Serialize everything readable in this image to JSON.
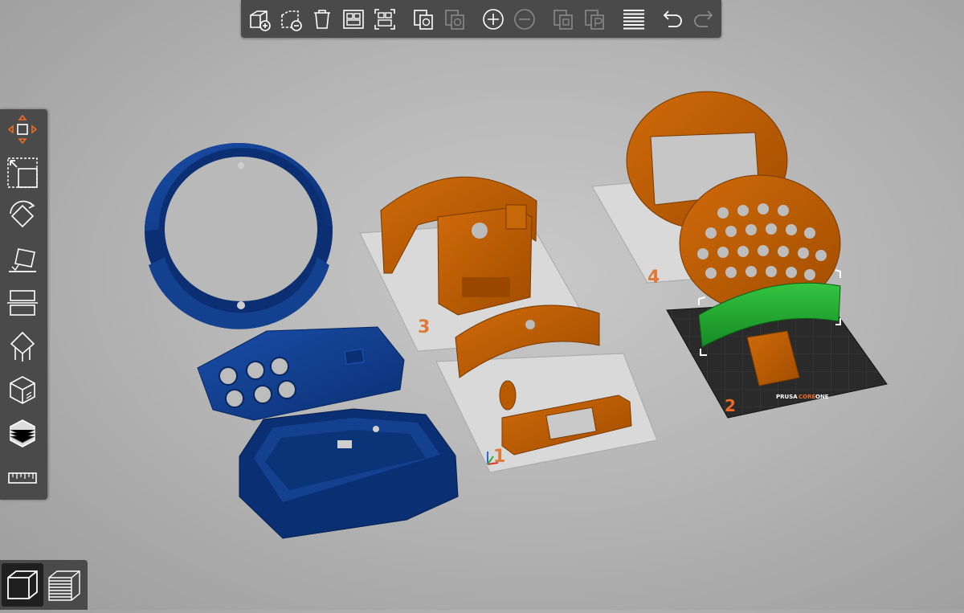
{
  "app": {
    "accent_color": "#ed6b21"
  },
  "top_toolbar": {
    "buttons": [
      {
        "name": "add-object",
        "icon": "cube-plus-icon",
        "enabled": true
      },
      {
        "name": "delete-selected",
        "icon": "cube-minus-dashed-icon",
        "enabled": true
      },
      {
        "name": "delete-all",
        "icon": "trash-icon",
        "enabled": true
      },
      {
        "name": "arrange",
        "icon": "arrange-icon",
        "enabled": true
      },
      {
        "name": "arrange-selection",
        "icon": "arrange-selection-icon",
        "enabled": true
      },
      {
        "name": "copy",
        "icon": "copy-icon",
        "enabled": true
      },
      {
        "name": "paste",
        "icon": "paste-icon",
        "enabled": false
      },
      {
        "name": "add-instance",
        "icon": "plus-circle-icon",
        "enabled": true
      },
      {
        "name": "remove-instance",
        "icon": "minus-circle-icon",
        "enabled": false
      },
      {
        "name": "split-to-objects",
        "icon": "split-objects-icon",
        "enabled": false
      },
      {
        "name": "split-to-parts",
        "icon": "split-parts-icon",
        "enabled": false
      },
      {
        "name": "variable-layer-height",
        "icon": "layers-icon",
        "enabled": true
      },
      {
        "name": "undo",
        "icon": "undo-icon",
        "enabled": true
      },
      {
        "name": "redo",
        "icon": "redo-icon",
        "enabled": false
      }
    ]
  },
  "left_toolbar": {
    "tools": [
      {
        "name": "move",
        "icon": "move-icon"
      },
      {
        "name": "scale",
        "icon": "scale-icon"
      },
      {
        "name": "rotate",
        "icon": "rotate-icon"
      },
      {
        "name": "place-on-face",
        "icon": "place-on-face-icon"
      },
      {
        "name": "cut",
        "icon": "cut-icon"
      },
      {
        "name": "supports",
        "icon": "supports-paint-icon"
      },
      {
        "name": "seam",
        "icon": "seam-paint-icon"
      },
      {
        "name": "mmu-paint",
        "icon": "mmu-paint-icon"
      },
      {
        "name": "measure",
        "icon": "ruler-icon"
      }
    ]
  },
  "view_toggle": {
    "modes": [
      {
        "name": "3d-view",
        "icon": "cube-icon",
        "active": true
      },
      {
        "name": "preview",
        "icon": "layers-stack-icon",
        "active": false
      }
    ]
  },
  "scene": {
    "colors": {
      "blue_parts": "#0d3a8a",
      "orange_parts": "#b85a00",
      "selected_part": "#21a131",
      "bed_plate": "#d8d8d8",
      "active_bed": "#2b2b2b",
      "bed_number": "#ed6b21"
    },
    "beds": [
      {
        "number": "1",
        "active": false
      },
      {
        "number": "2",
        "active": true,
        "brand": "PRUSA",
        "model": "CORE",
        "model_suffix": "ONE"
      },
      {
        "number": "3",
        "active": false
      },
      {
        "number": "4",
        "active": false
      }
    ]
  }
}
